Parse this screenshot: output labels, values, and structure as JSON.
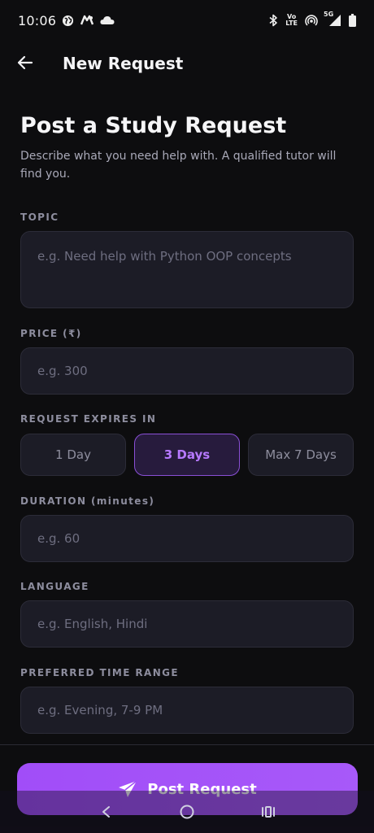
{
  "status_bar": {
    "time": "10:06",
    "network_label": "5G",
    "volte_top": "Vo",
    "volte_bottom": "LTE",
    "icons": [
      "globe-icon",
      "app-notification-icon",
      "cloud-icon",
      "bluetooth-icon",
      "volte-icon",
      "hotspot-icon",
      "signal-icon",
      "battery-icon"
    ]
  },
  "app_bar": {
    "title": "New Request"
  },
  "page": {
    "title": "Post a Study Request",
    "subtitle": "Describe what you need help with. A qualified tutor will find you."
  },
  "form": {
    "topic": {
      "label": "TOPIC",
      "placeholder": "e.g. Need help with Python OOP concepts",
      "value": ""
    },
    "price": {
      "label": "PRICE (₹)",
      "placeholder": "e.g. 300",
      "value": ""
    },
    "expiry": {
      "label": "REQUEST EXPIRES IN",
      "options": [
        "1 Day",
        "3 Days",
        "Max 7 Days"
      ],
      "selected": "3 Days"
    },
    "duration": {
      "label": "DURATION (minutes)",
      "placeholder": "e.g. 60",
      "value": ""
    },
    "language": {
      "label": "LANGUAGE",
      "placeholder": "e.g. English, Hindi",
      "value": ""
    },
    "time_range": {
      "label": "PREFERRED TIME RANGE",
      "placeholder": "e.g. Evening, 7-9 PM",
      "value": ""
    }
  },
  "submit": {
    "label": "Post Request",
    "icon": "send-icon"
  },
  "colors": {
    "background": "#0d0d0f",
    "field": "#1c1c26",
    "accent": "#a14df8",
    "accent_text": "#b679ff",
    "label": "#8d8d9e"
  }
}
